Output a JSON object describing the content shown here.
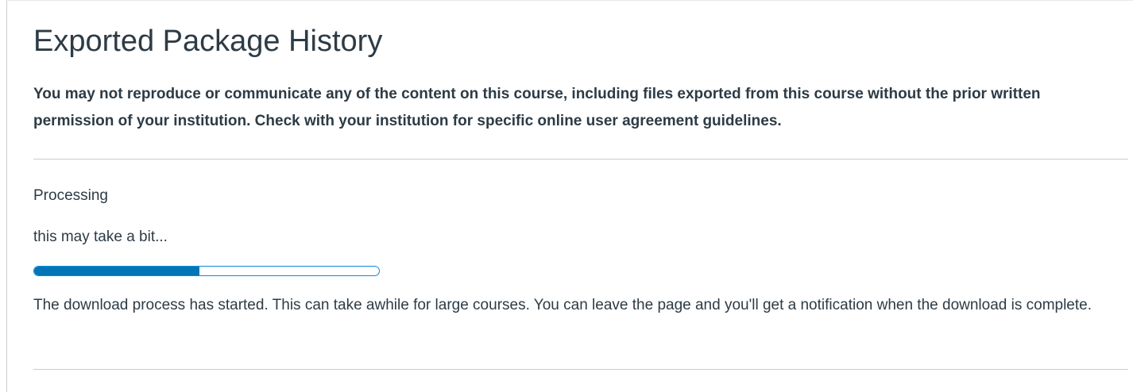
{
  "page": {
    "title": "Exported Package History",
    "notice": "You may not reproduce or communicate any of the content on this course, including files exported from this course without the prior written permission of your institution. Check with your institution for specific online user agreement guidelines."
  },
  "export": {
    "status": "Processing",
    "substatus": "this may take a bit...",
    "progress_fraction": 0.48,
    "message": "The download process has started. This can take awhile for large courses. You can leave the page and you'll get a notification when the download is complete."
  },
  "colors": {
    "text": "#2d3b45",
    "progress_fill": "#0374b5",
    "progress_border": "#0b8bd9",
    "divider": "#c7cdd1"
  }
}
